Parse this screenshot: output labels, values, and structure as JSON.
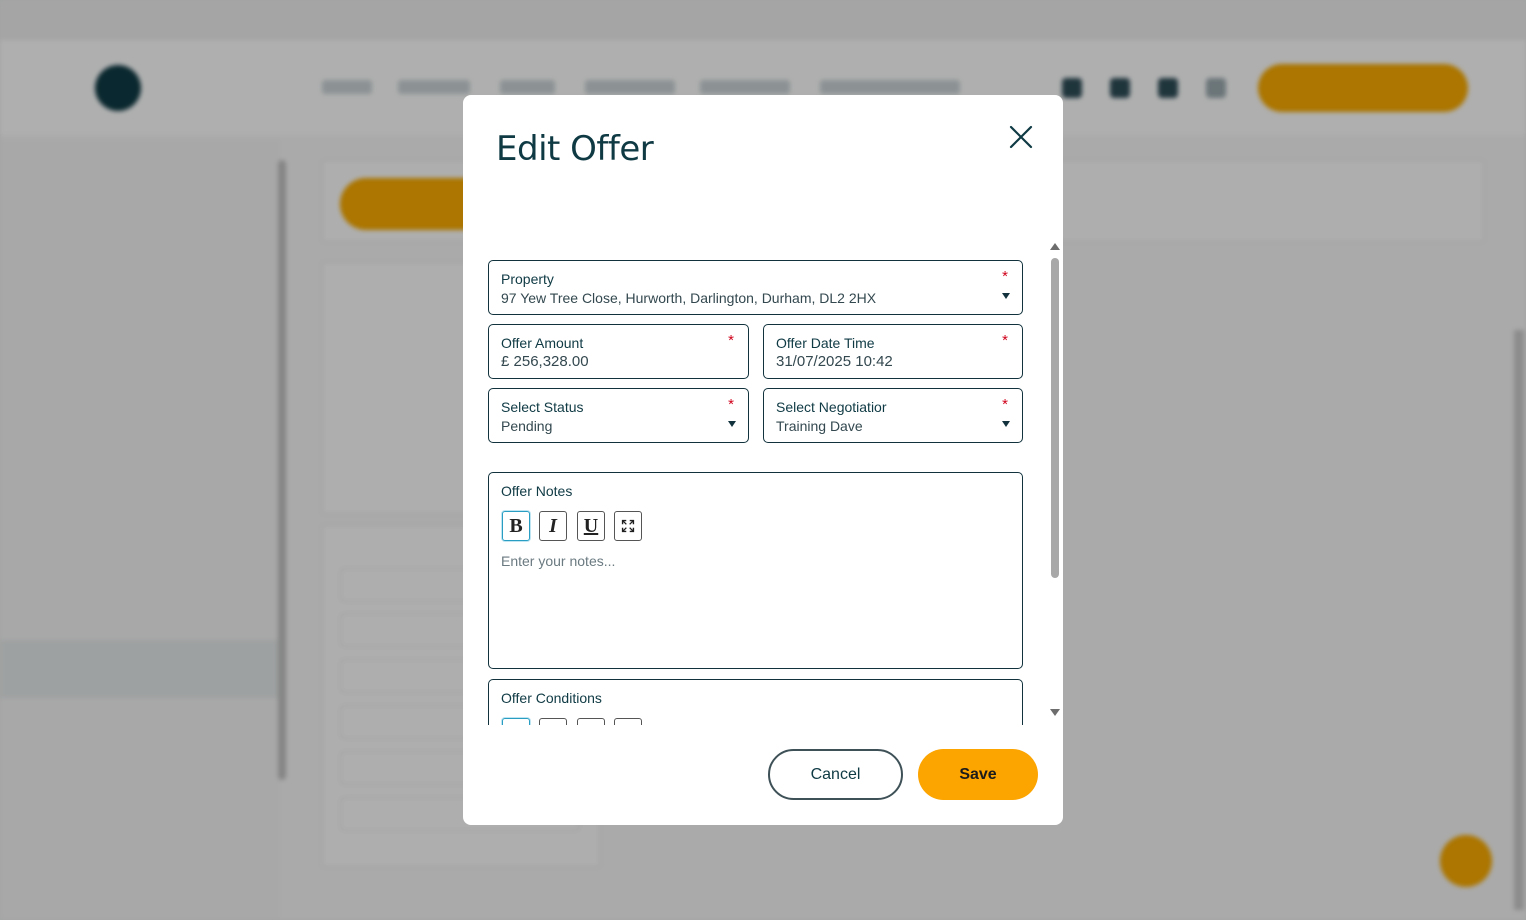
{
  "modal": {
    "title": "Edit Offer",
    "cancel_label": "Cancel",
    "save_label": "Save"
  },
  "form": {
    "property": {
      "label": "Property",
      "value": "97 Yew Tree Close, Hurworth, Darlington, Durham, DL2 2HX",
      "required_mark": "*"
    },
    "offer_amount": {
      "label": "Offer Amount",
      "value": "£ 256,328.00",
      "required_mark": "*"
    },
    "offer_date_time": {
      "label": "Offer Date Time",
      "value": "31/07/2025 10:42",
      "required_mark": "*"
    },
    "status": {
      "label": "Select Status",
      "value": "Pending",
      "required_mark": "*"
    },
    "negotiator": {
      "label": "Select Negotiatior",
      "value": "Training Dave",
      "required_mark": "*"
    },
    "offer_notes": {
      "label": "Offer Notes",
      "placeholder": "Enter your notes...",
      "toolbar": {
        "bold": "B",
        "italic": "I",
        "underline": "U",
        "fullscreen_icon": "expand-icon"
      }
    },
    "offer_conditions": {
      "label": "Offer Conditions"
    }
  },
  "colors": {
    "accent": "#fca400",
    "dark": "#0f3a44",
    "required": "#d0021b"
  }
}
